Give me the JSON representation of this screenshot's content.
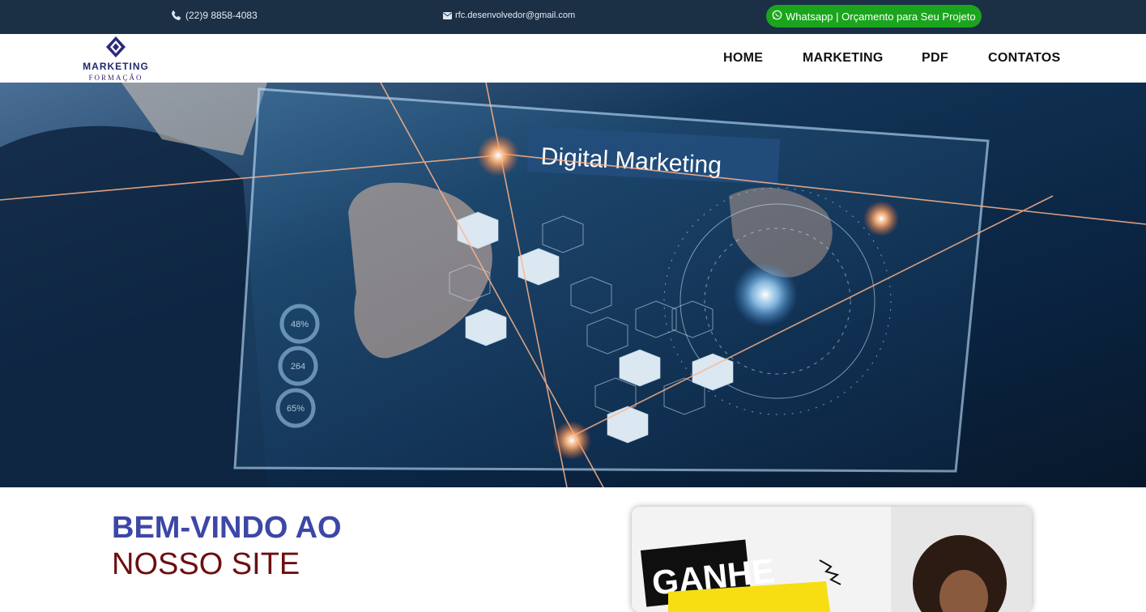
{
  "topbar": {
    "phone": "(22)9 8858-4083",
    "email": "rfc.desenvolvedor@gmail.com",
    "whatsapp": "Whatsapp | Orçamento para Seu Projeto",
    "icons": {
      "phone": "phone-icon",
      "email": "envelope-icon",
      "whatsapp": "whatsapp-icon"
    }
  },
  "brand": {
    "line1": "MARKETING",
    "line2": "FORMAÇÃO"
  },
  "nav": {
    "items": [
      {
        "label": "HOME"
      },
      {
        "label": "MARKETING"
      },
      {
        "label": "PDF"
      },
      {
        "label": "CONTATOS"
      }
    ]
  },
  "hero": {
    "screen_title": "Digital Marketing",
    "gauges": [
      "48%",
      "264",
      "65%"
    ]
  },
  "welcome": {
    "line1": "BEM-VINDO AO",
    "line2": "NOSSO SITE"
  },
  "promo": {
    "word1": "GANHE"
  },
  "colors": {
    "topbar": "#1b2f45",
    "whatsapp": "#1aa51d",
    "heading_blue": "#3c47a6",
    "heading_red": "#6d0e10"
  }
}
